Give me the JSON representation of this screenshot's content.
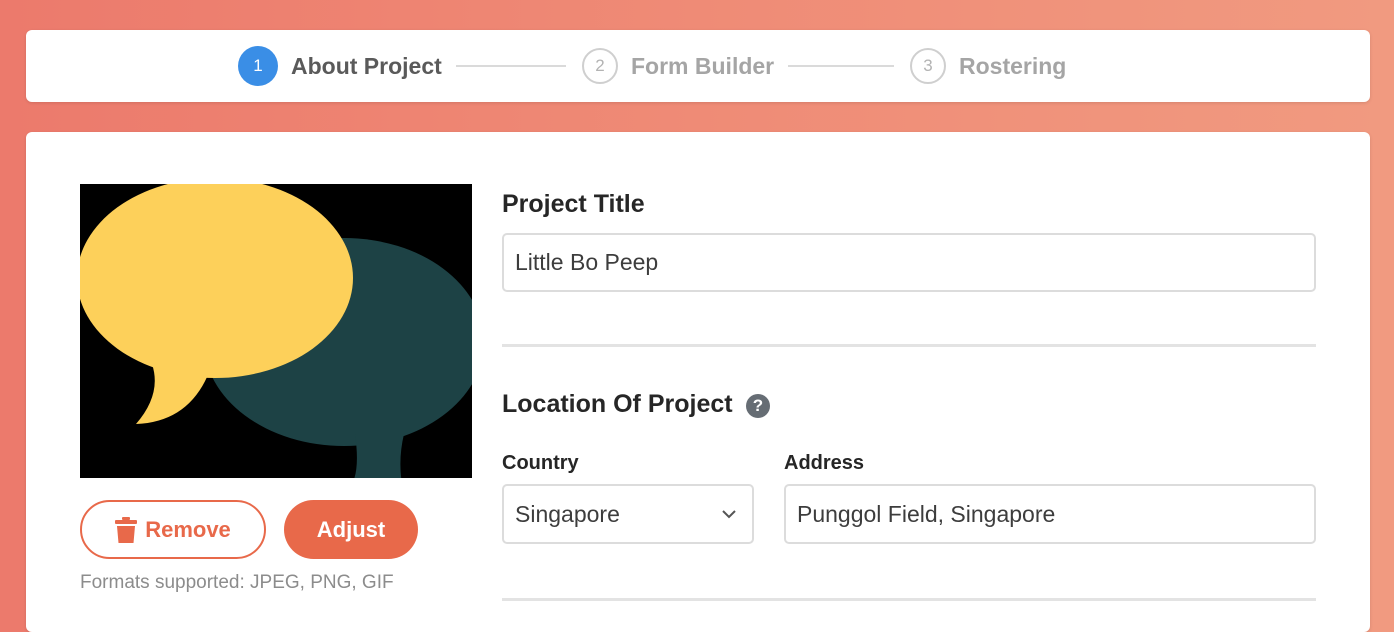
{
  "stepper": {
    "steps": [
      {
        "number": "1",
        "label": "About Project",
        "state": "active"
      },
      {
        "number": "2",
        "label": "Form Builder",
        "state": "inactive"
      },
      {
        "number": "3",
        "label": "Rostering",
        "state": "inactive"
      }
    ]
  },
  "image_panel": {
    "remove_label": "Remove",
    "adjust_label": "Adjust",
    "formats_text": "Formats supported: JPEG, PNG, GIF",
    "icons": {
      "remove": "trash-icon"
    }
  },
  "form": {
    "project_title_label": "Project Title",
    "project_title_value": "Little Bo Peep",
    "location_label": "Location Of Project",
    "help_icon_glyph": "?",
    "country_label": "Country",
    "country_value": "Singapore",
    "address_label": "Address",
    "address_value": "Punggol Field, Singapore"
  },
  "colors": {
    "accent": "#e8694a",
    "active_step": "#3a8ee6",
    "speech_bubble_yellow": "#fdd05a",
    "speech_bubble_teal": "#1d4245"
  }
}
